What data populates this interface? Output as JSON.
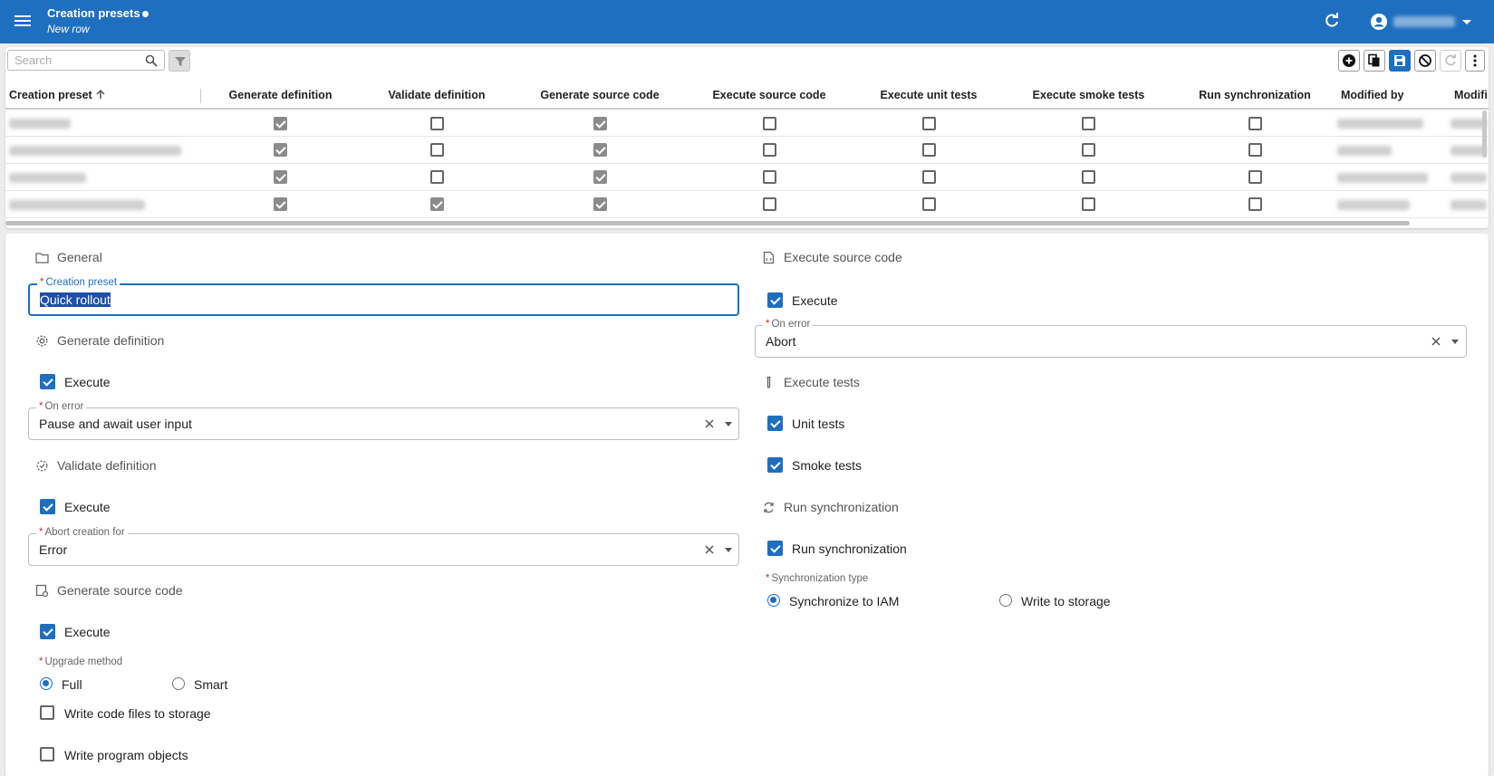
{
  "app": {
    "title": "Creation presets",
    "subtitle": "New row"
  },
  "grid": {
    "search_placeholder": "Search",
    "columns": [
      "Creation preset",
      "Generate definition",
      "Validate definition",
      "Generate source code",
      "Execute source code",
      "Execute unit tests",
      "Execute smoke tests",
      "Run synchronization",
      "Modified by",
      "Modifi"
    ],
    "sort_column": "Creation preset",
    "sort_direction": "ascending",
    "rows": [
      {
        "preset": "(blurred)",
        "values": [
          true,
          false,
          true,
          false,
          false,
          false,
          false
        ]
      },
      {
        "preset": "(blurred)",
        "values": [
          true,
          false,
          true,
          false,
          false,
          false,
          false
        ]
      },
      {
        "preset": "(blurred)",
        "values": [
          true,
          false,
          true,
          false,
          false,
          false,
          false
        ]
      },
      {
        "preset": "(blurred)",
        "values": [
          true,
          true,
          true,
          false,
          false,
          false,
          false
        ]
      }
    ]
  },
  "form": {
    "general": {
      "heading": "General",
      "preset_label": "Creation preset",
      "preset_value": "Quick rollout"
    },
    "generate_definition": {
      "heading": "Generate definition",
      "execute_label": "Execute",
      "execute_checked": true,
      "on_error_label": "On error",
      "on_error_value": "Pause and await user input"
    },
    "validate_definition": {
      "heading": "Validate definition",
      "execute_label": "Execute",
      "execute_checked": true,
      "abort_label": "Abort creation for",
      "abort_value": "Error"
    },
    "generate_source_code": {
      "heading": "Generate source code",
      "execute_label": "Execute",
      "execute_checked": true,
      "upgrade_label": "Upgrade method",
      "upgrade_options": [
        "Full",
        "Smart"
      ],
      "upgrade_selected": "Full",
      "write_files_label": "Write code files to storage",
      "write_files_checked": false,
      "write_objects_label": "Write program objects",
      "write_objects_checked": false
    },
    "execute_source_code": {
      "heading": "Execute source code",
      "execute_label": "Execute",
      "execute_checked": true,
      "on_error_label": "On error",
      "on_error_value": "Abort"
    },
    "execute_tests": {
      "heading": "Execute tests",
      "unit_label": "Unit tests",
      "unit_checked": true,
      "smoke_label": "Smoke tests",
      "smoke_checked": true
    },
    "run_synchronization": {
      "heading": "Run synchronization",
      "run_label": "Run synchronization",
      "run_checked": true,
      "type_label": "Synchronization type",
      "type_options": [
        "Synchronize to IAM",
        "Write to storage"
      ],
      "type_selected": "Synchronize to IAM"
    }
  },
  "colors": {
    "brand": "#1f6fbf",
    "required": "#d32f2f",
    "checkbox_grid": "#8b8b8b"
  }
}
